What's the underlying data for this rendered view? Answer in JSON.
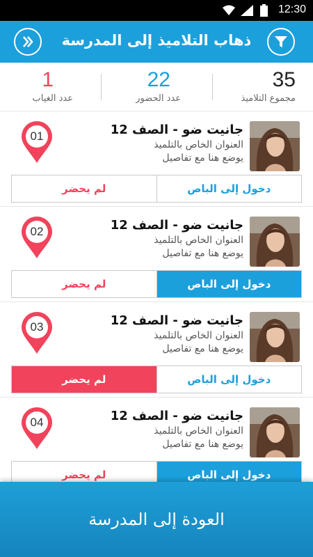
{
  "status_bar": {
    "time": "12:30"
  },
  "header": {
    "title": "ذهاب التلاميذ إلى المدرسة",
    "left_icon": "double-chevron-right-icon",
    "right_icon": "filter-icon"
  },
  "stats": {
    "total": {
      "value": "35",
      "label": "مجموع التلاميذ"
    },
    "present": {
      "value": "22",
      "label": "عدد الحضور"
    },
    "absent": {
      "value": "1",
      "label": "عدد الغياب"
    }
  },
  "students": [
    {
      "num": "01",
      "name": "جانيت ضو - الصف 12",
      "address": "العنوان الخاص بالتلميذ",
      "details": "يوضع هنا مع تفاصيل",
      "bus_label": "دخول إلى الباص",
      "absent_label": "لم يحضر",
      "state": "none"
    },
    {
      "num": "02",
      "name": "جانيت ضو - الصف 12",
      "address": "العنوان الخاص بالتلميذ",
      "details": "يوضع هنا مع تفاصيل",
      "bus_label": "دخول إلى الباص",
      "absent_label": "لم يحضر",
      "state": "bus"
    },
    {
      "num": "03",
      "name": "جانيت ضو - الصف 12",
      "address": "العنوان الخاص بالتلميذ",
      "details": "يوضع هنا مع تفاصيل",
      "bus_label": "دخول إلى الباص",
      "absent_label": "لم يحضر",
      "state": "absent"
    },
    {
      "num": "04",
      "name": "جانيت ضو - الصف 12",
      "address": "العنوان الخاص بالتلميذ",
      "details": "يوضع هنا مع تفاصيل",
      "bus_label": "دخول إلى الباص",
      "absent_label": "لم يحضر",
      "state": "bus"
    }
  ],
  "footer": {
    "label": "العودة إلى المدرسة"
  },
  "colors": {
    "primary": "#1ba0dc",
    "accent_red": "#f1435b",
    "status_bar": "#000000"
  }
}
